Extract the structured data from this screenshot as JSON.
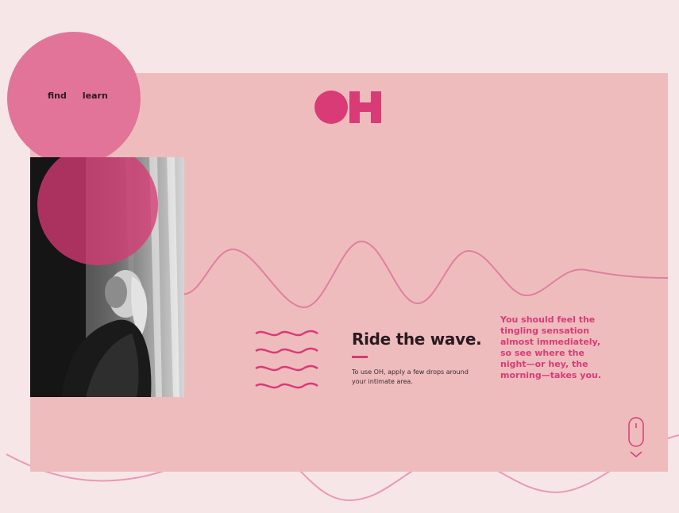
{
  "nav": {
    "items": [
      {
        "label": "find"
      },
      {
        "label": "learn"
      }
    ]
  },
  "logo": {
    "text": "OH"
  },
  "hero": {
    "headline": "Ride the wave.",
    "body": "To use OH, apply a few drops around your intimate area.",
    "callout": "You should feel the tingling sensation almost immediately, so see where the night—or hey, the morning—takes you."
  },
  "icons": {
    "scroll": "mouse-scroll-icon",
    "waves": "wavy-lines-icon"
  },
  "colors": {
    "page_background": "#f7e6e8",
    "card_background": "#efbcbe",
    "accent": "#d93b77",
    "wave_line": "#e07f9e",
    "text_dark": "#2a1a20"
  }
}
